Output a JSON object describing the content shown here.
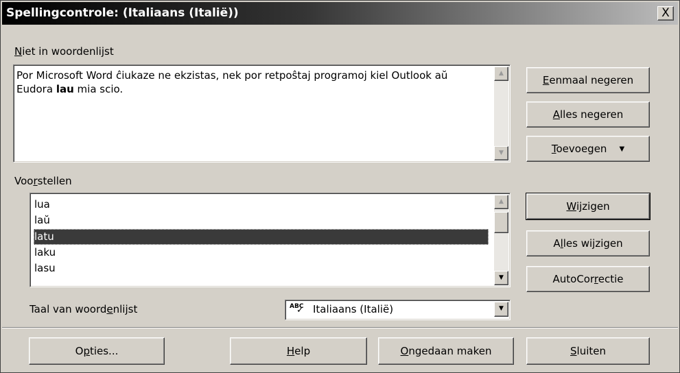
{
  "window": {
    "title": "Spellingcontrole: (Italiaans (Italië))",
    "close_label": "X"
  },
  "not_in_dictionary": {
    "label_first": "N",
    "label_rest": "iet in woordenlijst",
    "text_before": "Por Microsoft Word ĉiukaze ne ekzistas, nek por retpoŝtaj programoj kiel Outlook aŭ Eudora ",
    "text_error": "lau",
    "text_after": " mia scio."
  },
  "suggestions": {
    "label_pre": "Voo",
    "label_key": "r",
    "label_post": "stellen",
    "items": [
      "lua",
      "laŭ",
      "latu",
      "laku",
      "lasu"
    ],
    "selected_index": 2
  },
  "buttons": {
    "ignore_once": {
      "key": "E",
      "rest": "enmaal negeren"
    },
    "ignore_all": {
      "key": "A",
      "rest": "lles negeren"
    },
    "add": {
      "key": "T",
      "rest": "oevoegen",
      "arrow": "▼"
    },
    "change": {
      "pre": "",
      "key": "W",
      "rest": "ijzigen"
    },
    "change_all": {
      "pre": "A",
      "key": "l",
      "rest": "les wijzigen"
    },
    "autocorrect": {
      "pre": "AutoCor",
      "key": "r",
      "rest": "ectie"
    }
  },
  "language": {
    "label_pre": "Taal van woord",
    "label_key": "e",
    "label_post": "nlijst",
    "value": "Italiaans (Italië)",
    "icon_text": "ABC",
    "arrow": "▼"
  },
  "footer": {
    "options": {
      "pre": "O",
      "key": "p",
      "rest": "ties..."
    },
    "help": {
      "key": "H",
      "rest": "elp"
    },
    "undo": {
      "key": "O",
      "rest": "ngedaan maken"
    },
    "close": {
      "key": "S",
      "rest": "luiten"
    }
  },
  "scroll_arrows": {
    "up": "▲",
    "down": "▼"
  },
  "colors": {
    "dialog_bg": "#d4d0c8",
    "selection": "#3a3a3a"
  }
}
